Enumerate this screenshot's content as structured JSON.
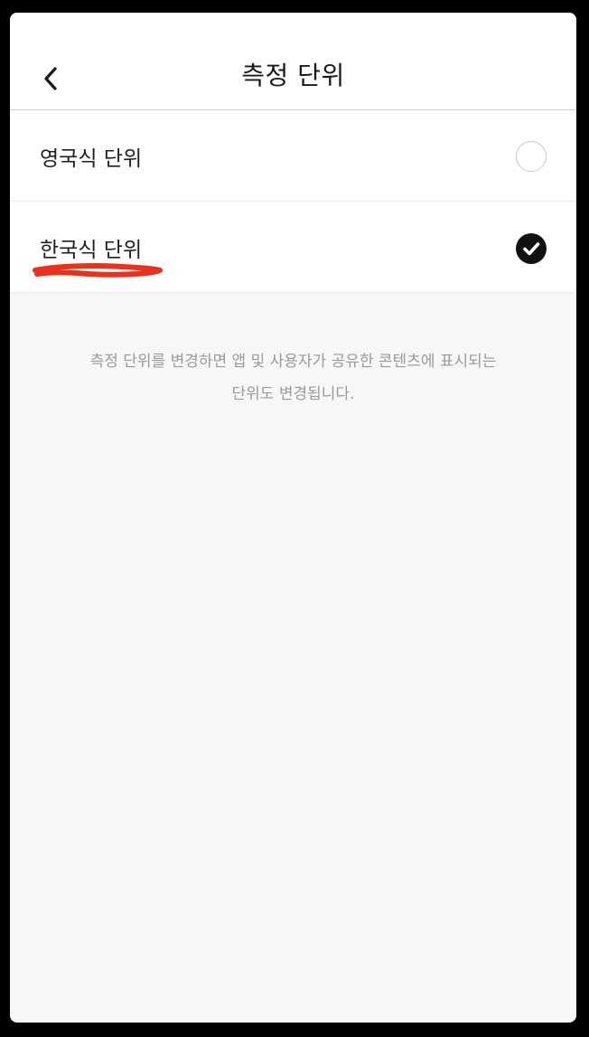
{
  "header": {
    "title": "측정 단위",
    "back_icon": "chevron-left-icon"
  },
  "options": [
    {
      "label": "영국식 단위",
      "selected": false
    },
    {
      "label": "한국식 단위",
      "selected": true
    }
  ],
  "info": {
    "line1": "측정 단위를 변경하면 앱 및 사용자가 공유한 콘텐츠에 표시되는",
    "line2": "단위도 변경됩니다."
  },
  "colors": {
    "background": "#f7f7f7",
    "surface": "#ffffff",
    "text": "#1f1f1f",
    "muted": "#9a9a9a",
    "check": "#111111",
    "annotation": "#e8321e"
  }
}
